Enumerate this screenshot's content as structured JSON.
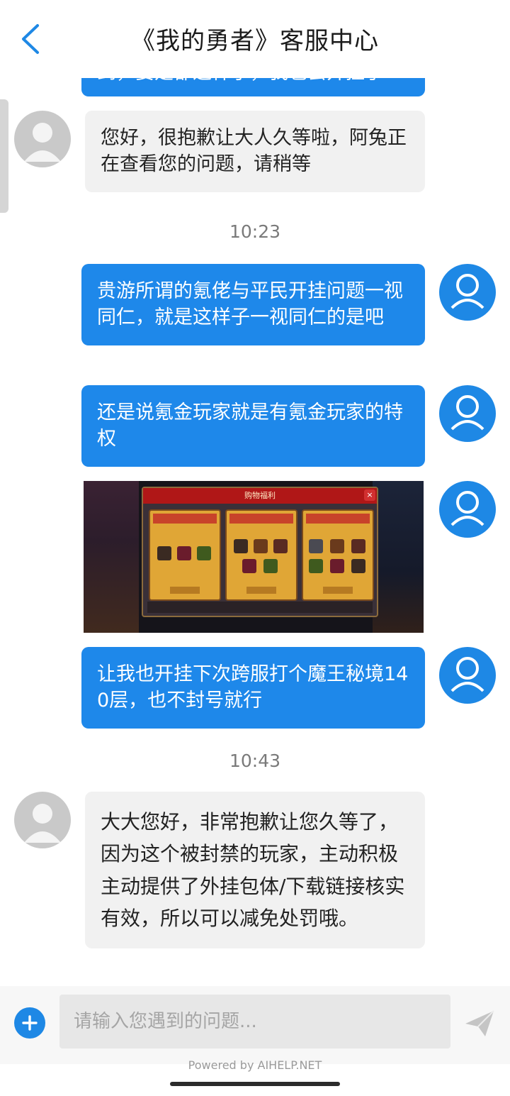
{
  "header": {
    "title": "《我的勇者》客服中心"
  },
  "messages": [
    {
      "from": "user",
      "text": "到，要是都这样子，我也会开挂了"
    },
    {
      "from": "agent",
      "text": "您好，很抱歉让大人久等啦，阿兔正在查看您的问题，请稍等"
    },
    {
      "type": "time",
      "text": "10:23"
    },
    {
      "from": "user",
      "text": "贵游所谓的氪佬与平民开挂问题一视同仁，就是这样子一视同仁的是吧"
    },
    {
      "from": "user",
      "text": "还是说氪金玩家就是有氪金玩家的特权"
    },
    {
      "from": "user",
      "type": "image",
      "caption": "购物福利"
    },
    {
      "from": "user",
      "text": "让我也开挂下次跨服打个魔王秘境140层，也不封号就行"
    },
    {
      "type": "time",
      "text": "10:43"
    },
    {
      "from": "agent",
      "text": "大大您好，非常抱歉让您久等了，因为这个被封禁的玩家，主动积极主动提供了外挂包体/下载链接核实有效，所以可以减免处罚哦。"
    }
  ],
  "input": {
    "placeholder": "请输入您遇到的问题..."
  },
  "footer": {
    "powered_by": "Powered by AIHELP.NET"
  },
  "colors": {
    "accent": "#1e88e5",
    "user_bubble": "#1e88ea",
    "agent_bubble": "#f1f1f1"
  },
  "icons": {
    "back": "chevron-left-icon",
    "avatar": "person-icon",
    "add": "plus-icon",
    "send": "paper-plane-icon"
  }
}
